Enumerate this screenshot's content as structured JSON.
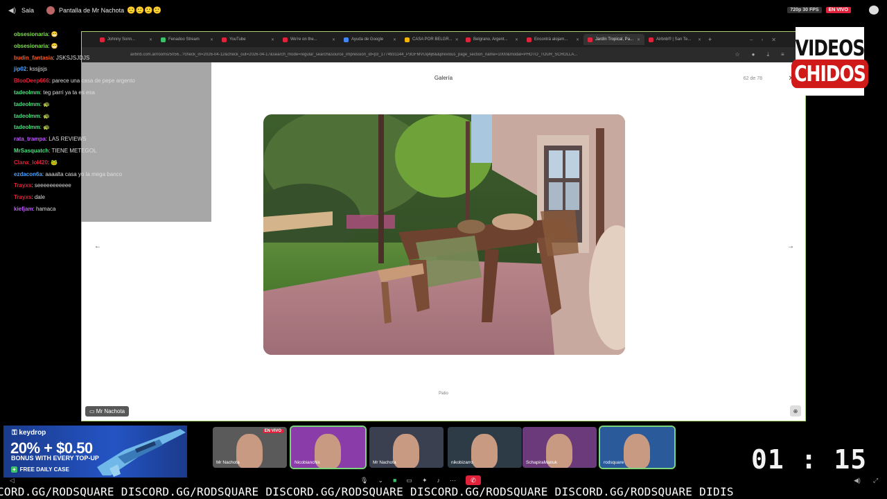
{
  "topbar": {
    "room": "Sala",
    "screen_title": "Pantalla de Mr Nachota",
    "fps_badge": "720p 30 FPS",
    "live_badge": "EN VIVO"
  },
  "browser": {
    "tabs": [
      {
        "label": "Johnny Sonn...",
        "color": "#e0223a"
      },
      {
        "label": "Fenadoo Stream",
        "color": "#3ac26a"
      },
      {
        "label": "YouTube",
        "color": "#e0223a"
      },
      {
        "label": "We're on the...",
        "color": "#e0223a"
      },
      {
        "label": "Ayuda de Google",
        "color": "#4285f4"
      },
      {
        "label": "CASA POR BELGR...",
        "color": "#f4b400"
      },
      {
        "label": "Belgrano, Argent...",
        "color": "#e0223a"
      },
      {
        "label": "Encontrá alojam...",
        "color": "#e0223a"
      },
      {
        "label": "Jardín Tropical, Pa...",
        "color": "#e0223a",
        "active": true
      },
      {
        "label": "Airbnb® | San Te...",
        "color": "#e0223a"
      }
    ],
    "url": "airbnb.com.ar/rooms/5056...?check_in=2026-04-12&check_out=2026-04-17&search_mode=regular_search&source_impression_id=p3_1774931144_P3GFMVUq4jB&&previous_page_section_name=1000&modal=PHOTO_TOUR_SCROLLA..."
  },
  "gallery": {
    "title": "Galería",
    "counter": "62 de 78",
    "caption": "Patio",
    "presenter_tag": "Mr Nachota"
  },
  "chat": [
    {
      "user": "obsesionaria",
      "color": "#7ee04a",
      "text": "😁"
    },
    {
      "user": "obsesionaria",
      "color": "#7ee04a",
      "text": "😁"
    },
    {
      "user": "budin_fantasia",
      "color": "#ff5a1f",
      "text": "JSKSJSJDJS"
    },
    {
      "user": "jip02",
      "color": "#4aa3ff",
      "text": "kssjjsjs"
    },
    {
      "user": "BlooDeep666",
      "color": "#e0223a",
      "text": "parece una casa de pepe argento"
    },
    {
      "user": "tadeolmm",
      "color": "#4ae07e",
      "text": "teg parri ya ta es esa"
    },
    {
      "user": "tadeolmm",
      "color": "#4ae07e",
      "text": "🐢"
    },
    {
      "user": "tadeolmm",
      "color": "#4ae07e",
      "text": "🐢"
    },
    {
      "user": "tadeolmm",
      "color": "#4ae07e",
      "text": "🐢"
    },
    {
      "user": "rata_trampa",
      "color": "#c05aff",
      "text": "LAS REVIEWS"
    },
    {
      "user": "MrSasquatch",
      "color": "#4ae07e",
      "text": "TIENE METEGOL"
    },
    {
      "user": "Clanx_lol420",
      "color": "#e0223a",
      "text": "🐸"
    },
    {
      "user": "ezdacon6a",
      "color": "#4aa3ff",
      "text": "aaaalta casa yo la mega banco"
    },
    {
      "user": "Trayxs",
      "color": "#e0223a",
      "text": "seeeeeeeeeee"
    },
    {
      "user": "Trayxs",
      "color": "#e0223a",
      "text": "dale"
    },
    {
      "user": "kiefjam",
      "color": "#c05aff",
      "text": "hamaca"
    }
  ],
  "logo": {
    "line1": "VIDEOS",
    "line2": "CHIDOS"
  },
  "ad": {
    "brand": "keydrop",
    "promo": "20% + $0.50",
    "sub": "BONUS WITH EVERY TOP-UP",
    "cta": "FREE DAILY CASE"
  },
  "participants": [
    {
      "name": "Mr Nachota",
      "live": "EN VIVO",
      "bg": "#5a5a5a"
    },
    {
      "name": "Nicobianchix",
      "bg": "#8a3ca8",
      "active": true
    },
    {
      "name": "Mr Nachota",
      "bg": "#3a4050"
    },
    {
      "name": "nikobizarro",
      "bg": "#2d3b46"
    },
    {
      "name": "SchapiraManuk",
      "bg": "#6a3a7a"
    },
    {
      "name": "rodsquare",
      "bg": "#2a5a9a",
      "active": true
    }
  ],
  "timer": "01 : 15",
  "ticker": "CORD.GG/RODSQUARE DISCORD.GG/RODSQUARE DISCORD.GG/RODSQUARE DISCORD.GG/RODSQUARE DISCORD.GG/RODSQUARE DIDIS"
}
